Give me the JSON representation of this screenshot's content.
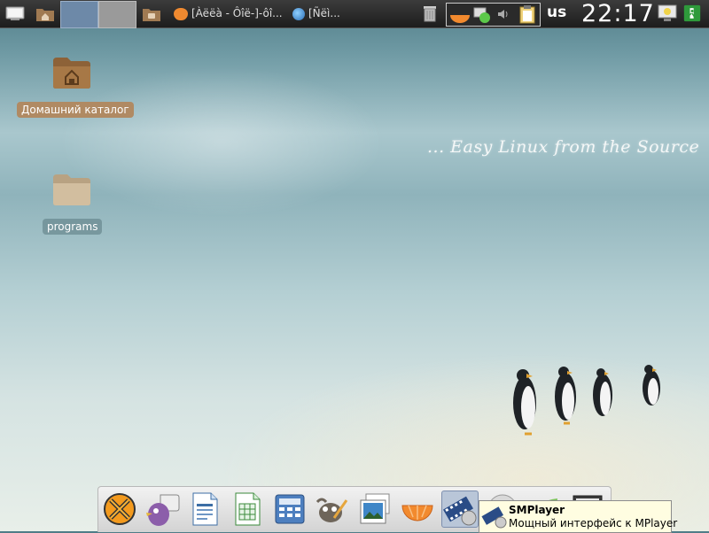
{
  "top_panel": {
    "tasks": [
      {
        "label": "[Àëëà - Ôîë-]-ôî..."
      },
      {
        "label": "[Ñëì..."
      }
    ],
    "keyboard_layout": "us",
    "clock": "22:17"
  },
  "desktop": {
    "icons": [
      {
        "label": "Домашний каталог"
      },
      {
        "label": "programs"
      }
    ],
    "tagline": "... Easy Linux from the Source"
  },
  "dock": {
    "items": [
      {
        "icon": "crossover-icon"
      },
      {
        "icon": "pidgin-icon"
      },
      {
        "icon": "writer-icon"
      },
      {
        "icon": "calc-icon"
      },
      {
        "icon": "calculator-icon"
      },
      {
        "icon": "gimp-icon"
      },
      {
        "icon": "image-viewer-icon"
      },
      {
        "icon": "clementine-icon"
      },
      {
        "icon": "smplayer-icon"
      },
      {
        "icon": "disc-icon"
      },
      {
        "icon": "leaf-icon"
      },
      {
        "icon": "monitor-icon"
      }
    ]
  },
  "tooltip": {
    "title": "SMPlayer",
    "description": "Мощный интерфейс к MPlayer"
  },
  "colors": {
    "panel": "#2a2a2a",
    "selected_label": "#b08a63",
    "tooltip_bg": "#fffde1"
  }
}
